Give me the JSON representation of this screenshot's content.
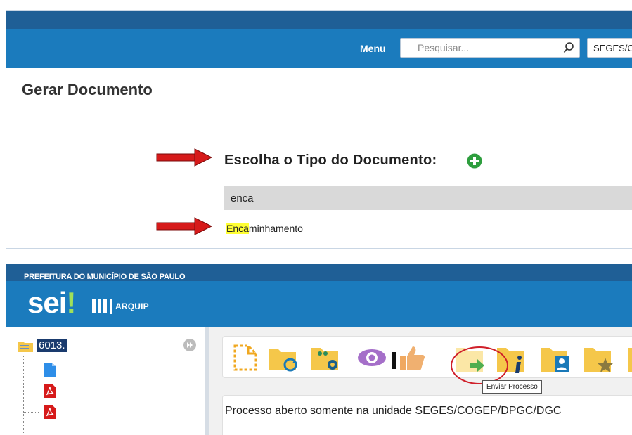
{
  "top_panel": {
    "menu_label": "Menu",
    "search_placeholder": "Pesquisar...",
    "unit_label": "SEGES/COGEP",
    "page_title": "Gerar Documento",
    "choose_type_label": "Escolha o Tipo do Documento:",
    "filter_value": "enca",
    "result": {
      "highlight": "Enca",
      "rest": "minhamento"
    }
  },
  "bottom_panel": {
    "prefeitura": "PREFEITURA DO MUNICÍPIO DE SÃO PAULO",
    "logo_text": "sei",
    "logo_bang": "!",
    "arquip_label": "ARQUIP",
    "process_number": "6013.",
    "toolbar_icons": [
      "incluir-documento-icon",
      "atualizar-andamento-icon",
      "atribuir-processo-icon",
      "acompanhamento-especial-icon",
      "ciencia-icon",
      "enviar-processo-icon",
      "consultar-alterar-processo-icon",
      "gerenciar-interessados-icon",
      "favoritos-icon"
    ],
    "tooltip": "Enviar Processo",
    "status_text": "Processo aberto somente na unidade SEGES/COGEP/DPGC/DGC"
  },
  "colors": {
    "header_dark": "#1f5f96",
    "header_blue": "#1b7bbd",
    "add_green": "#2e9e3e",
    "arrow_red": "#d61a1a",
    "highlight": "#ffff33",
    "folder_yellow": "#f5c74a",
    "circle_red": "#d0202a"
  }
}
